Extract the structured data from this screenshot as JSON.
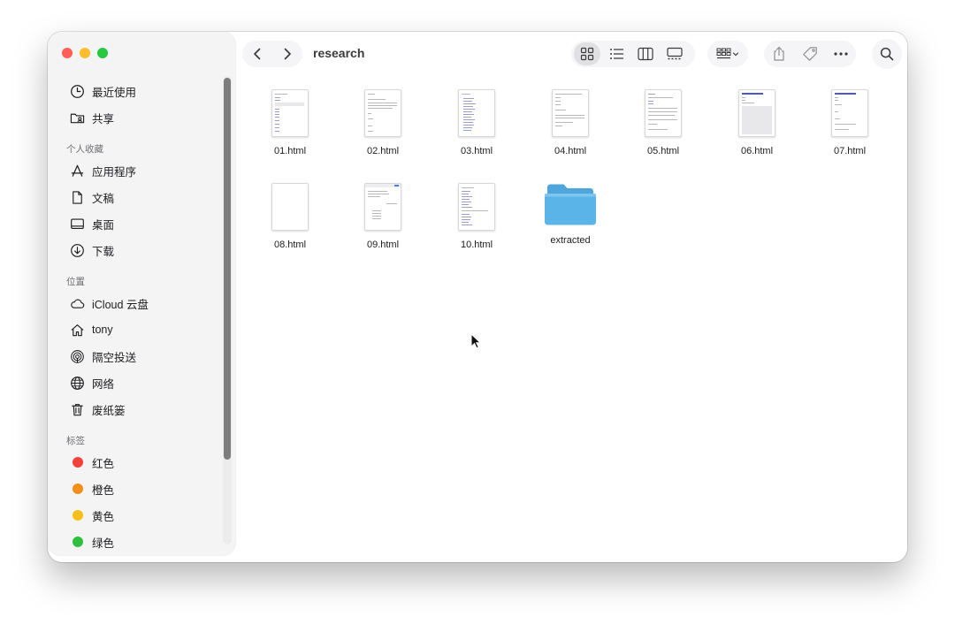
{
  "window": {
    "title": "research"
  },
  "sidebar": {
    "favorites_items": [
      {
        "label": "最近使用",
        "icon": "clock-icon"
      },
      {
        "label": "共享",
        "icon": "shared-folder-icon"
      }
    ],
    "sections": [
      {
        "title": "个人收藏",
        "items": [
          {
            "label": "应用程序",
            "icon": "applications-icon"
          },
          {
            "label": "文稿",
            "icon": "document-icon"
          },
          {
            "label": "桌面",
            "icon": "desktop-icon"
          },
          {
            "label": "下载",
            "icon": "download-icon"
          }
        ]
      },
      {
        "title": "位置",
        "items": [
          {
            "label": "iCloud 云盘",
            "icon": "cloud-icon"
          },
          {
            "label": "tony",
            "icon": "home-icon"
          },
          {
            "label": "隔空投送",
            "icon": "airdrop-icon"
          },
          {
            "label": "网络",
            "icon": "globe-icon"
          },
          {
            "label": "废纸篓",
            "icon": "trash-icon"
          }
        ]
      },
      {
        "title": "标签",
        "items": [
          {
            "label": "红色",
            "color": "#f2403b"
          },
          {
            "label": "橙色",
            "color": "#f58d1a"
          },
          {
            "label": "黄色",
            "color": "#f5c01a"
          },
          {
            "label": "绿色",
            "color": "#2fbf3e"
          }
        ]
      }
    ]
  },
  "toolbar": {
    "back_icon": "chevron-left-icon",
    "forward_icon": "chevron-right-icon",
    "views": [
      "grid-view-icon",
      "list-view-icon",
      "column-view-icon",
      "gallery-view-icon"
    ],
    "active_view": "grid-view-icon",
    "group_icon": "group-by-icon",
    "actions": [
      "share-icon",
      "tag-icon",
      "more-icon"
    ],
    "search_icon": "search-icon"
  },
  "files": [
    {
      "name": "01.html"
    },
    {
      "name": "02.html"
    },
    {
      "name": "03.html"
    },
    {
      "name": "04.html"
    },
    {
      "name": "05.html"
    },
    {
      "name": "06.html"
    },
    {
      "name": "07.html"
    },
    {
      "name": "08.html"
    },
    {
      "name": "09.html"
    },
    {
      "name": "10.html"
    },
    {
      "name": "extracted",
      "kind": "folder"
    }
  ],
  "colors": {
    "folder": "#5ab4e8",
    "accent": "#007aff"
  }
}
